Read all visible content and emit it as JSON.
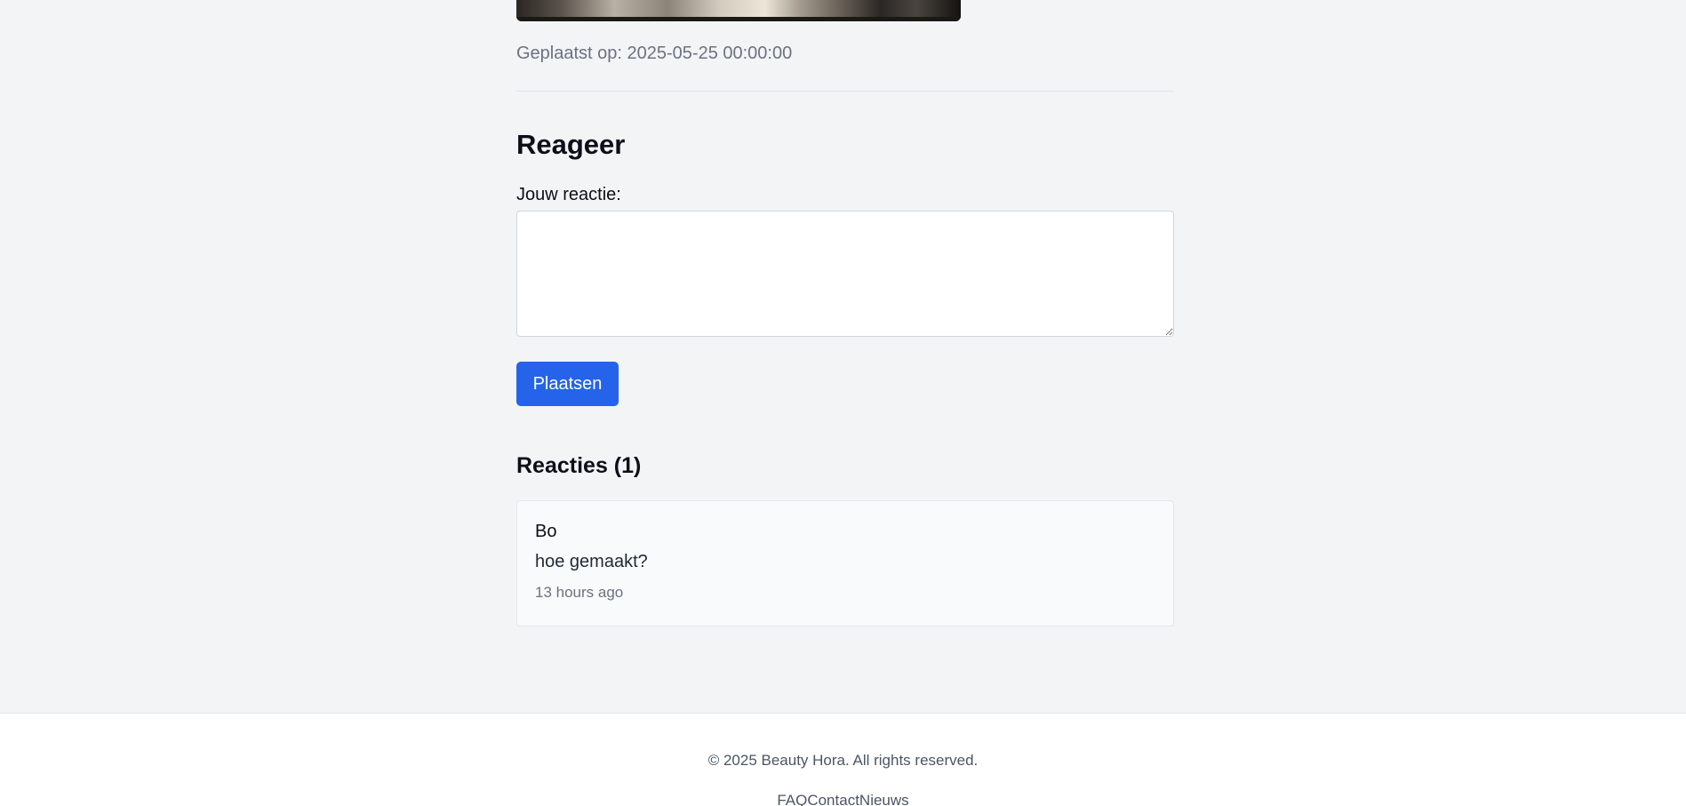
{
  "post": {
    "posted_label": "Geplaatst op: 2025-05-25 00:00:00"
  },
  "reply": {
    "title": "Reageer",
    "field_label": "Jouw reactie:",
    "textarea_value": "",
    "submit_label": "Plaatsen"
  },
  "comments": {
    "title": "Reacties (1)",
    "items": [
      {
        "author": "Bo",
        "body": "hoe gemaakt?",
        "time": "13 hours ago"
      }
    ]
  },
  "footer": {
    "copyright": "© 2025 Beauty Hora. All rights reserved.",
    "links": [
      "FAQ",
      "Contact",
      "Nieuws"
    ]
  },
  "colors": {
    "page_background": "#f3f4f6",
    "accent": "#2563eb",
    "muted_text": "#6b7280"
  }
}
